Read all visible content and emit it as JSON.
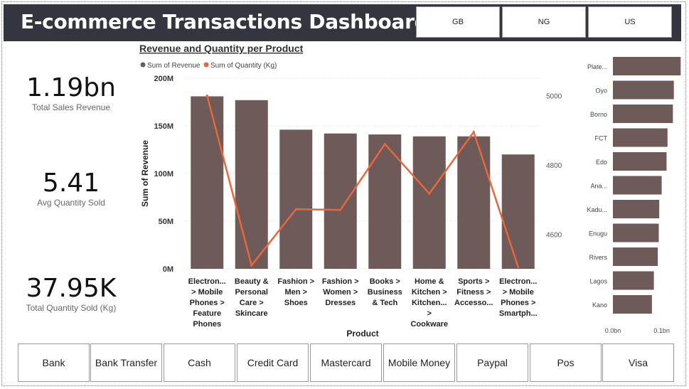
{
  "header": {
    "title": "E-commerce Transactions Dashboard",
    "country_buttons": [
      "GB",
      "NG",
      "US"
    ]
  },
  "kpis": [
    {
      "value": "1.19bn",
      "label": "Total Sales Revenue"
    },
    {
      "value": "5.41",
      "label": "Avg Quantity Sold"
    },
    {
      "value": "37.95K",
      "label": "Total Quantity Sold (Kg)"
    }
  ],
  "payment_buttons": [
    "Bank",
    "Bank Transfer",
    "Cash",
    "Credit Card",
    "Mastercard",
    "Mobile Money",
    "Paypal",
    "Pos",
    "Visa"
  ],
  "chart_data": [
    {
      "type": "bar",
      "title": "Revenue and Quantity per Product",
      "xlabel": "Product",
      "ylabel": "Sum of Revenue",
      "y2label": "Sum of Quantity (Kg)",
      "legend": [
        "Sum of Revenue",
        "Sum of Quantity (Kg)"
      ],
      "legend_position": "top-left",
      "categories": [
        [
          "Electron...",
          "> Mobile",
          "Phones >",
          "Feature",
          "Phones"
        ],
        [
          "Beauty &",
          "Personal",
          "Care >",
          "Skincare"
        ],
        [
          "Fashion >",
          "Men >",
          "Shoes"
        ],
        [
          "Fashion >",
          "Women >",
          "Dresses"
        ],
        [
          "Books >",
          "Business",
          "& Tech"
        ],
        [
          "Home &",
          "Kitchen >",
          "Kitchen...",
          ">",
          "Cookware"
        ],
        [
          "Sports >",
          "Fitness >",
          "Accesso..."
        ],
        [
          "Electron...",
          "> Mobile",
          "Phones >",
          "Smartph..."
        ]
      ],
      "series": [
        {
          "name": "Sum of Revenue",
          "values": [
            181000000,
            177000000,
            146000000,
            142000000,
            141000000,
            139000000,
            139000000,
            120000000
          ],
          "color": "#6e5a59"
        },
        {
          "name": "Sum of Quantity (Kg)",
          "values": [
            5000,
            4510,
            4672,
            4670,
            4860,
            4717,
            4895,
            4505
          ],
          "color": "#e8673a"
        }
      ],
      "y_ticks": [
        "0M",
        "50M",
        "100M",
        "150M",
        "200M"
      ],
      "ylim": [
        0,
        200000000
      ],
      "y2_ticks": [
        "4600",
        "4800",
        "5000"
      ],
      "y2lim": [
        4500,
        5050
      ]
    },
    {
      "type": "bar",
      "orientation": "horizontal",
      "categories": [
        "Plate...",
        "Oyo",
        "Borno",
        "FCT",
        "Edo",
        "Ana...",
        "Kadu...",
        "Enugu",
        "Rivers",
        "Lagos",
        "Kano"
      ],
      "values": [
        0.139,
        0.125,
        0.123,
        0.112,
        0.11,
        0.1,
        0.095,
        0.094,
        0.092,
        0.084,
        0.08
      ],
      "x_ticks": [
        "0.0bn",
        "0.1bn"
      ],
      "xlim": [
        0,
        0.14
      ],
      "color": "#6e5a59"
    }
  ]
}
